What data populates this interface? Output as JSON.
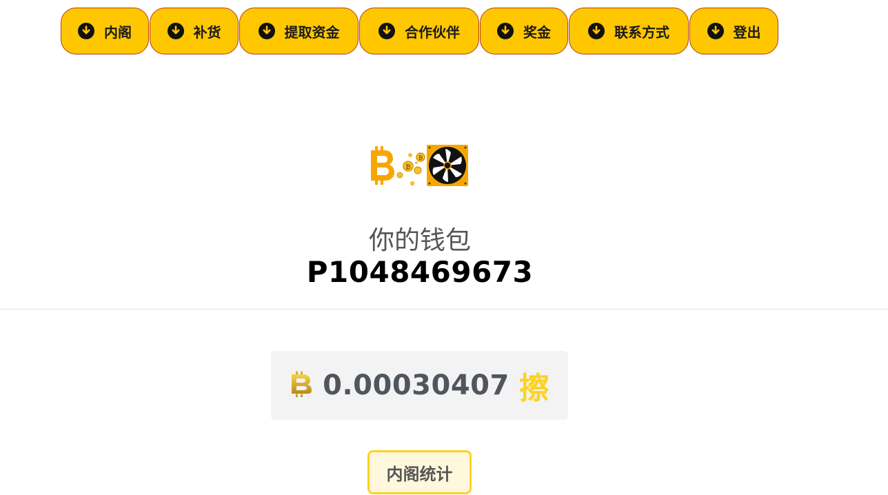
{
  "nav": {
    "items": [
      {
        "label": "内阁",
        "icon": "arrow-down-circle-icon"
      },
      {
        "label": "补货",
        "icon": "arrow-down-circle-icon"
      },
      {
        "label": "提取资金",
        "icon": "arrow-down-circle-icon"
      },
      {
        "label": "合作伙伴",
        "icon": "arrow-down-circle-icon"
      },
      {
        "label": "奖金",
        "icon": "arrow-down-circle-icon"
      },
      {
        "label": "联系方式",
        "icon": "arrow-down-circle-icon"
      },
      {
        "label": "登出",
        "icon": "arrow-down-circle-icon"
      }
    ]
  },
  "wallet": {
    "label": "你的钱包",
    "id": "P1048469673"
  },
  "balance": {
    "amount": "0.00030407",
    "unit": "擦",
    "icon": "bitcoin-icon"
  },
  "stats_button": {
    "label": "内阁统计"
  },
  "colors": {
    "accent": "#ffc700",
    "balance_unit": "#ffd21f",
    "logo_orange": "#f7a600"
  }
}
